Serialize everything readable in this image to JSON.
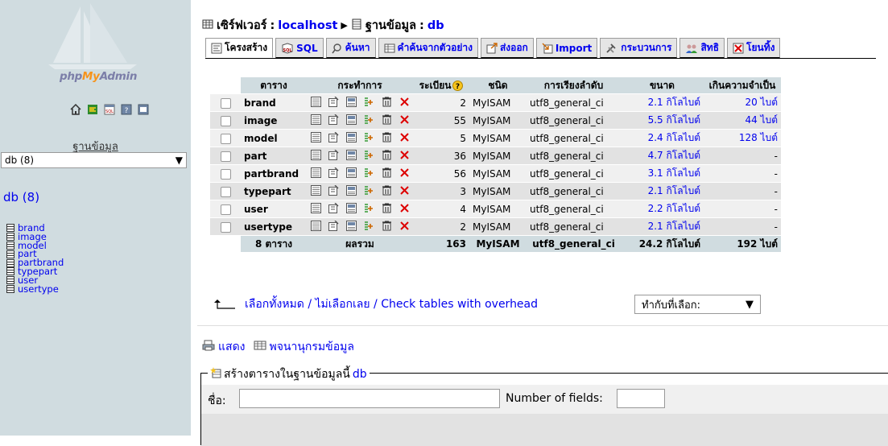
{
  "nav": {
    "logo_php": "php",
    "logo_my": "My",
    "logo_admin": "Admin",
    "icons": [
      "home-icon",
      "exit-icon",
      "sql-query-icon",
      "help-icon",
      "sql-docs-icon"
    ],
    "db_label": "ฐานข้อมูล",
    "db_select_value": "db (8)",
    "db_title": "db (8)",
    "tables": [
      "brand",
      "image",
      "model",
      "part",
      "partbrand",
      "typepart",
      "user",
      "usertype"
    ]
  },
  "breadcrumb": {
    "server_label": "เซิร์ฟเวอร์",
    "server_value": "localhost",
    "db_label": "ฐานข้อมูล",
    "db_value": "db"
  },
  "tabs": [
    {
      "label": "โครงสร้าง",
      "icon": "structure-icon",
      "active": true
    },
    {
      "label": "SQL",
      "icon": "sql-icon"
    },
    {
      "label": "ค้นหา",
      "icon": "search-icon"
    },
    {
      "label": "คำค้นจากตัวอย่าง",
      "icon": "query-icon"
    },
    {
      "label": "ส่งออก",
      "icon": "export-icon"
    },
    {
      "label": "Import",
      "icon": "import-icon"
    },
    {
      "label": "กระบวนการ",
      "icon": "operations-icon"
    },
    {
      "label": "สิทธิ",
      "icon": "privileges-icon"
    },
    {
      "label": "โยนทิ้ง",
      "icon": "drop-icon"
    }
  ],
  "table": {
    "headers": {
      "table": "ตาราง",
      "action": "กระทำการ",
      "records": "ระเบียน",
      "type": "ชนิด",
      "collation": "การเรียงลำดับ",
      "size": "ขนาด",
      "overhead": "เกินความจำเป็น"
    },
    "action_icons": [
      "browse-icon",
      "structure-icon",
      "search-icon",
      "insert-icon",
      "empty-icon",
      "drop-icon"
    ],
    "rows": [
      {
        "name": "brand",
        "records": "2",
        "type": "MyISAM",
        "collation": "utf8_general_ci",
        "size": "2.1 กิโลไบต์",
        "overhead": "20 ไบต์"
      },
      {
        "name": "image",
        "records": "55",
        "type": "MyISAM",
        "collation": "utf8_general_ci",
        "size": "5.5 กิโลไบต์",
        "overhead": "44 ไบต์"
      },
      {
        "name": "model",
        "records": "5",
        "type": "MyISAM",
        "collation": "utf8_general_ci",
        "size": "2.4 กิโลไบต์",
        "overhead": "128 ไบต์"
      },
      {
        "name": "part",
        "records": "36",
        "type": "MyISAM",
        "collation": "utf8_general_ci",
        "size": "4.7 กิโลไบต์",
        "overhead": "-"
      },
      {
        "name": "partbrand",
        "records": "56",
        "type": "MyISAM",
        "collation": "utf8_general_ci",
        "size": "3.1 กิโลไบต์",
        "overhead": "-"
      },
      {
        "name": "typepart",
        "records": "3",
        "type": "MyISAM",
        "collation": "utf8_general_ci",
        "size": "2.1 กิโลไบต์",
        "overhead": "-"
      },
      {
        "name": "user",
        "records": "4",
        "type": "MyISAM",
        "collation": "utf8_general_ci",
        "size": "2.2 กิโลไบต์",
        "overhead": "-"
      },
      {
        "name": "usertype",
        "records": "2",
        "type": "MyISAM",
        "collation": "utf8_general_ci",
        "size": "2.1 กิโลไบต์",
        "overhead": "-"
      }
    ],
    "footer": {
      "count": "8 ตาราง",
      "sum_label": "ผลรวม",
      "records": "163",
      "type": "MyISAM",
      "collation": "utf8_general_ci",
      "size": "24.2 กิโลไบต์",
      "overhead": "192 ไบต์"
    }
  },
  "below_table": {
    "check_all": "เลือกทั้งหมด",
    "separator": " / ",
    "uncheck_all": "ไม่เลือกเลย",
    "check_overhead": "Check tables with overhead",
    "with_selected": "ทำกับที่เลือก:"
  },
  "links": {
    "print": "แสดง",
    "dictionary": "พจนานุกรมข้อมูล"
  },
  "create_table": {
    "legend": "สร้างตารางในฐานข้อมูลนี้",
    "db": "db",
    "name_label": "ชื่อ:",
    "fields_label": "Number of fields:"
  }
}
